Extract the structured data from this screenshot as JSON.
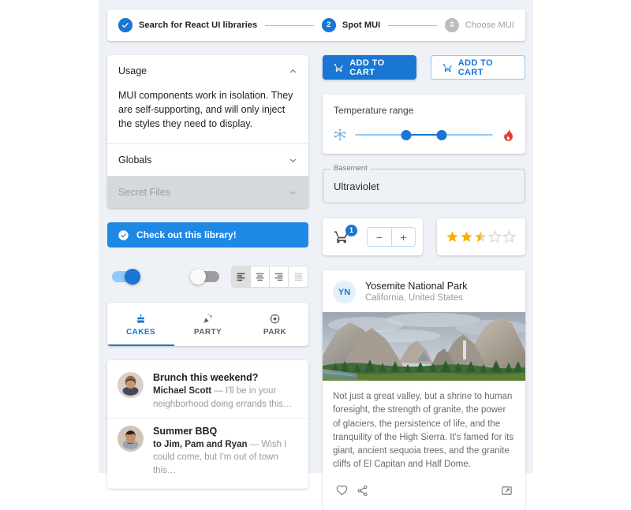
{
  "colors": {
    "primary": "#1976d2",
    "alert_bg": "#1e88e5",
    "star": "#faaf00",
    "page_bg": "#ffffff",
    "content_bg": "#eef1f5",
    "disabled_bg": "#d5d8dc"
  },
  "stepper": {
    "steps": [
      {
        "number": "1",
        "label": "Search for React UI libraries",
        "state": "completed",
        "icon": "check-icon"
      },
      {
        "number": "2",
        "label": "Spot MUI",
        "state": "active"
      },
      {
        "number": "3",
        "label": "Choose MUI",
        "state": "upcoming"
      }
    ]
  },
  "accordion": {
    "items": [
      {
        "title": "Usage",
        "expanded": true,
        "icon": "chevron-up-icon",
        "body": "MUI components work in isolation. They are self-supporting, and will only inject the styles they need to display."
      },
      {
        "title": "Globals",
        "expanded": false,
        "icon": "chevron-down-icon"
      },
      {
        "title": "Secret Files",
        "expanded": false,
        "disabled": true,
        "icon": "chevron-down-icon"
      }
    ]
  },
  "alert": {
    "text": "Check out this library!",
    "icon": "check-circle-icon",
    "severity": "info"
  },
  "switches": [
    {
      "name": "switch-on",
      "checked": true
    },
    {
      "name": "switch-off",
      "checked": false
    }
  ],
  "align_toggle": {
    "options": [
      {
        "value": "left",
        "icon": "format-align-left-icon",
        "selected": true,
        "disabled": false
      },
      {
        "value": "center",
        "icon": "format-align-center-icon",
        "selected": false,
        "disabled": false
      },
      {
        "value": "right",
        "icon": "format-align-right-icon",
        "selected": false,
        "disabled": false
      },
      {
        "value": "justify",
        "icon": "format-align-justify-icon",
        "selected": false,
        "disabled": true
      }
    ]
  },
  "tabs": {
    "items": [
      {
        "label": "CAKES",
        "icon": "cake-icon",
        "active": true
      },
      {
        "label": "PARTY",
        "icon": "party-popper-icon",
        "active": false
      },
      {
        "label": "PARK",
        "icon": "park-circle-icon",
        "active": false
      }
    ]
  },
  "messages": [
    {
      "title": "Brunch this weekend?",
      "sender": "Michael Scott",
      "separator": "—",
      "preview": "I'll be in your neighborhood doing errands this…",
      "avatar": "avatar-michael-scott"
    },
    {
      "title": "Summer BBQ",
      "sender": "to Jim, Pam and Ryan",
      "separator": "—",
      "preview": "Wish I could come, but I'm out of town this…",
      "avatar": "avatar-sandra-adams"
    }
  ],
  "buttons": {
    "contained": {
      "label": "ADD TO CART",
      "icon": "shopping-cart-icon",
      "variant": "contained"
    },
    "outlined": {
      "label": "ADD TO CART",
      "icon": "shopping-cart-icon",
      "variant": "outlined"
    }
  },
  "slider": {
    "label": "Temperature range",
    "start_icon": "snowflake-icon",
    "end_icon": "whatshot-icon",
    "value_low_pct": 37,
    "value_high_pct": 63
  },
  "text_field": {
    "label": "Basement",
    "value": "Ultraviolet",
    "placeholder": "Basement"
  },
  "cart_badge": {
    "icon": "shopping-cart-icon",
    "count": "1"
  },
  "quantity_stepper": {
    "decrement": "−",
    "increment": "+"
  },
  "rating": {
    "value": 2.5,
    "max": 5,
    "filled": 2,
    "half": 1,
    "empty": 2
  },
  "card": {
    "avatar_initials": "YN",
    "title": "Yosemite National Park",
    "subtitle": "California, United States",
    "image_alt": "yosemite-valley-photo",
    "body": "Not just a great valley, but a shrine to human foresight, the strength of granite, the power of glaciers, the persistence of life, and the tranquility of the High Sierra. It's famed for its giant, ancient sequoia trees, and the granite cliffs of El Capitan and Half Dome.",
    "actions": [
      {
        "name": "favorite-icon"
      },
      {
        "name": "share-icon"
      },
      {
        "name": "expand-handle-icon"
      }
    ]
  }
}
